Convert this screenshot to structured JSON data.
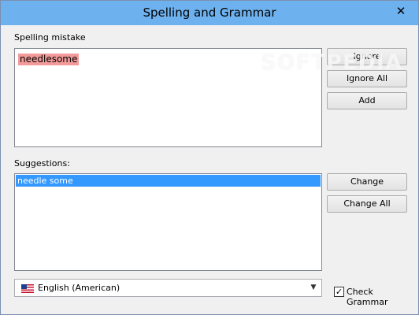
{
  "window": {
    "title": "Spelling and Grammar",
    "close_glyph": "✕"
  },
  "mistake": {
    "label": "Spelling mistake",
    "word": "needlesome"
  },
  "actions": {
    "ignore": "Ignore",
    "ignore_all": "Ignore All",
    "add": "Add",
    "change": "Change",
    "change_all": "Change All"
  },
  "suggestions": {
    "label": "Suggestions:",
    "items": [
      "needle some"
    ]
  },
  "language": {
    "selected": "English (American)",
    "flag_icon": "us-flag-icon"
  },
  "grammar": {
    "label": "Check Grammar",
    "checked": true,
    "check_glyph": "✓"
  },
  "watermark": "SOFTPEDIA",
  "colors": {
    "titlebar": "#6db1ee",
    "mistake_highlight": "#f49a9a",
    "selection": "#3399ff"
  }
}
